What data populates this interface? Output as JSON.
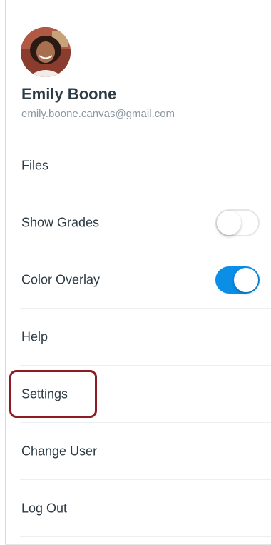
{
  "user": {
    "name": "Emily Boone",
    "email": "emily.boone.canvas@gmail.com"
  },
  "menu": [
    {
      "label": "Files"
    },
    {
      "label": "Show Grades",
      "toggle": false
    },
    {
      "label": "Color Overlay",
      "toggle": true
    },
    {
      "label": "Help"
    },
    {
      "label": "Settings",
      "highlighted": true
    },
    {
      "label": "Change User"
    },
    {
      "label": "Log Out"
    }
  ],
  "colors": {
    "accent": "#0b8ee6",
    "highlight_border": "#8e1b22",
    "text": "#2d3b45",
    "secondary_text": "#8b969e"
  }
}
